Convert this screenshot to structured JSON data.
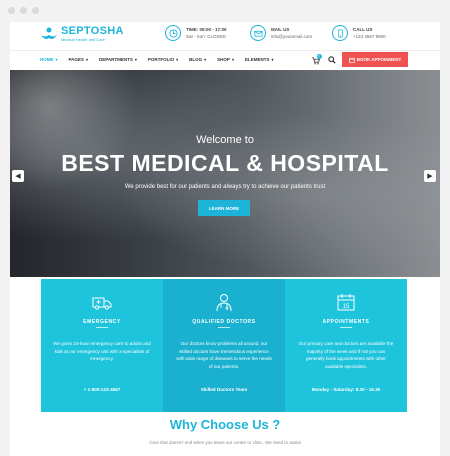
{
  "logo": {
    "name": "SEPTOSHA",
    "tagline": "Medical Health and Care"
  },
  "contacts": [
    {
      "icon": "clock-icon",
      "label": "TIME: 09:00 - 17:00",
      "value": "Sat - Sun: CLOSED"
    },
    {
      "icon": "mail-icon",
      "label": "MAIL US",
      "value": "info@youremail.com"
    },
    {
      "icon": "phone-icon",
      "label": "CALL US",
      "value": "+123 4567 8900"
    }
  ],
  "nav": {
    "items": [
      "HOME",
      "PAGES",
      "DEPARTMENTS",
      "PORTFOLIO",
      "BLOG",
      "SHOP",
      "ELEMENTS"
    ],
    "cart_count": "0",
    "book_label": "BOOK APPOINMENT"
  },
  "hero": {
    "welcome": "Welcome to",
    "title": "BEST MEDICAL & HOSPITAL",
    "subtitle": "We provide best for our patients and always try to achieve our patients trust",
    "button": "LEARN MORE"
  },
  "cards": [
    {
      "icon": "ambulance-icon",
      "title": "EMERGENCY",
      "text": "We gives 24-hour emergency care to adults and kids at our emergency unit with a specialists of emergency.",
      "footer": "+ 1-800-123-4567",
      "color": "#1ec3dc"
    },
    {
      "icon": "doctor-icon",
      "title": "QUALIFIED DOCTORS",
      "text": "Our doctors know problems all around, our skilled doctors have tremendous experience with wide range of diseases to serve the needs of our patients.",
      "footer": "Skilled Doctors Team",
      "color": "#19b1cf"
    },
    {
      "icon": "calendar-icon",
      "title": "APPOINTMENTS",
      "text": "Our primary care and doctors are available the majority of the week and if not you can generally book appointments with other available specialists.",
      "footer": "Monday - Saturday: 8.30 - 16.30",
      "color": "#1ec3dc"
    }
  ],
  "why": {
    "title": "Why Choose Us ?",
    "subtitle": "Care that doesn't end when you leave our center or clinic. We need to assist"
  },
  "colors": {
    "accent": "#1eb4d9",
    "book": "#f05252"
  }
}
